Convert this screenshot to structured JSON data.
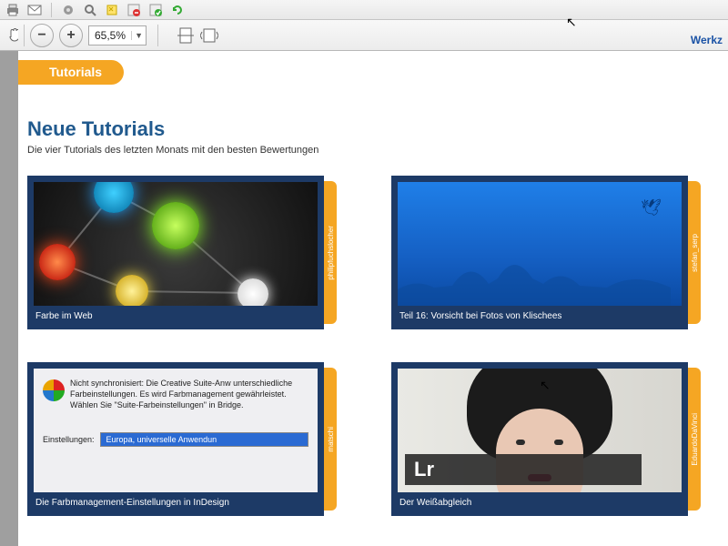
{
  "toolbar2": {
    "zoom_value": "65,5%",
    "right_link": "Werkz"
  },
  "page": {
    "tab_label": "Tutorials",
    "heading": "Neue Tutorials",
    "subheading": "Die vier Tutorials des letzten Monats mit den besten Bewertungen"
  },
  "cards": [
    {
      "caption": "Farbe im Web",
      "author": "philipfuchslocher"
    },
    {
      "caption": "Teil 16: Vorsicht bei Fotos von Klischees",
      "author": "stefan_serp"
    },
    {
      "caption": "Die Farbmanagement-Einstellungen in InDesign",
      "author": "matschi"
    },
    {
      "caption": "Der Weißabgleich",
      "author": "EduardoDaVinci"
    }
  ],
  "thumb3": {
    "msg": "Nicht synchronisiert: Die Creative Suite-Anw unterschiedliche Farbeinstellungen. Es wird Farbmanagement gewährleistet. Wählen Sie \"Suite-Farbeinstellungen\" in Bridge.",
    "label": "Einstellungen:",
    "value": "Europa, universelle Anwendun"
  },
  "thumb4": {
    "lr": "Lr"
  },
  "icons": {
    "print": "print-icon",
    "mail": "mail-icon",
    "gear": "gear-icon",
    "search": "search-icon",
    "note": "note-icon",
    "reject": "reject-icon",
    "accept": "accept-icon",
    "refresh": "refresh-icon",
    "hand": "hand-icon",
    "zoom_out": "zoom-out-icon",
    "zoom_in": "zoom-in-icon",
    "pagefit": "page-fit-icon",
    "pagewidth": "page-width-icon"
  }
}
